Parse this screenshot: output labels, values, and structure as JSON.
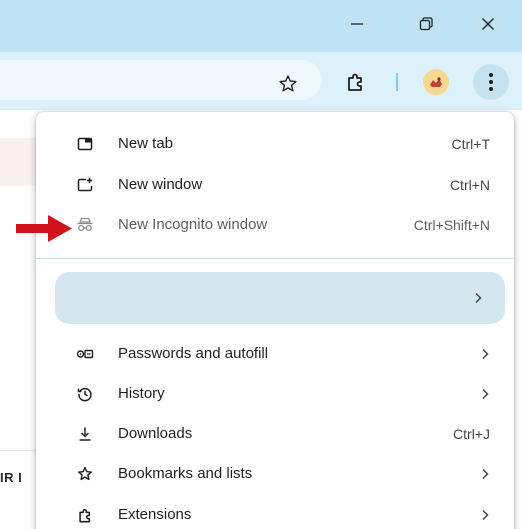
{
  "colors": {
    "titlebar": "#bfe3f4",
    "toolbar": "#ddf1fb",
    "menu_background": "#ffffff",
    "profile_row": "#d5e7ee",
    "annotation_arrow": "#d0101b"
  },
  "window_controls": [
    {
      "name": "minimize",
      "icon": "minimize-icon"
    },
    {
      "name": "restore",
      "icon": "restore-icon"
    },
    {
      "name": "close",
      "icon": "close-icon"
    }
  ],
  "toolbar": {
    "bookmark_icon": "star-icon",
    "extensions_icon": "puzzle-icon",
    "profile_icon": "avatar",
    "menu_icon": "kebab-icon"
  },
  "page": {
    "partial_text": "IR I"
  },
  "menu": {
    "items": [
      {
        "label": "New tab",
        "shortcut": "Ctrl+T",
        "icon": "new-tab-icon"
      },
      {
        "label": "New window",
        "shortcut": "Ctrl+N",
        "icon": "new-window-icon"
      },
      {
        "label": "New Incognito window",
        "shortcut": "Ctrl+Shift+N",
        "icon": "incognito-icon"
      },
      {
        "label": "Passwords and autofill",
        "shortcut": "",
        "icon": "key-icon",
        "submenu": true
      },
      {
        "label": "History",
        "shortcut": "",
        "icon": "history-icon",
        "submenu": true
      },
      {
        "label": "Downloads",
        "shortcut": "Ctrl+J",
        "icon": "download-icon"
      },
      {
        "label": "Bookmarks and lists",
        "shortcut": "",
        "icon": "star-icon",
        "submenu": true
      },
      {
        "label": "Extensions",
        "shortcut": "",
        "icon": "puzzle-icon",
        "submenu": true
      }
    ],
    "profile_row": {
      "label": "",
      "submenu": true
    }
  },
  "annotation": {
    "icon": "red-arrow-icon",
    "points_to": "New Incognito window"
  }
}
